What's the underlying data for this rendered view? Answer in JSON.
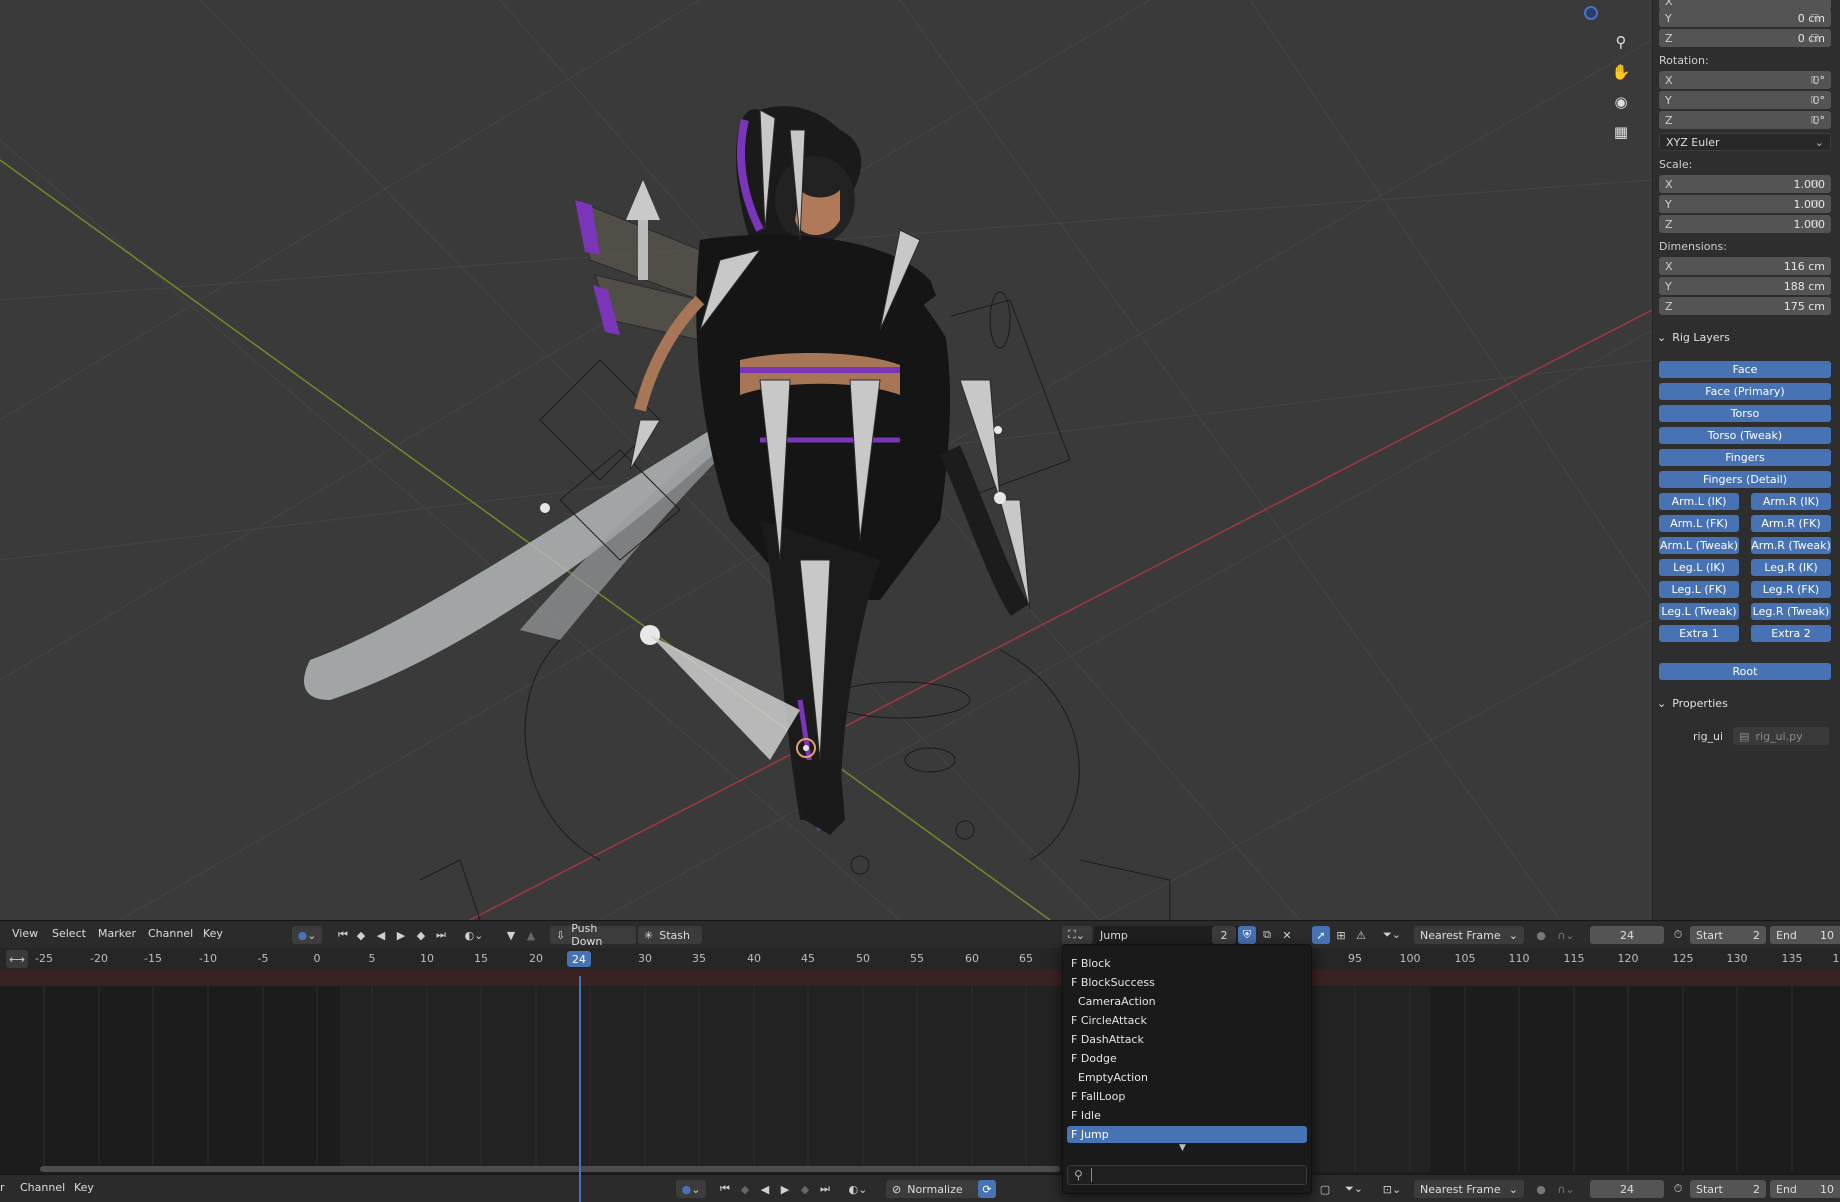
{
  "npanel": {
    "location_y": {
      "axis": "Y",
      "value": "0 cm"
    },
    "location_z": {
      "axis": "Z",
      "value": "0 cm"
    },
    "rotation_label": "Rotation:",
    "rotation": [
      {
        "axis": "X",
        "value": "0°"
      },
      {
        "axis": "Y",
        "value": "0°"
      },
      {
        "axis": "Z",
        "value": "0°"
      }
    ],
    "rotation_mode": "XYZ Euler",
    "scale_label": "Scale:",
    "scale": [
      {
        "axis": "X",
        "value": "1.000"
      },
      {
        "axis": "Y",
        "value": "1.000"
      },
      {
        "axis": "Z",
        "value": "1.000"
      }
    ],
    "dimensions_label": "Dimensions:",
    "dimensions": [
      {
        "axis": "X",
        "value": "116 cm"
      },
      {
        "axis": "Y",
        "value": "188 cm"
      },
      {
        "axis": "Z",
        "value": "175 cm"
      }
    ],
    "rig_layers_title": "Rig Layers",
    "rig_layers": {
      "face": "Face",
      "face_primary": "Face (Primary)",
      "torso": "Torso",
      "torso_tweak": "Torso (Tweak)",
      "fingers": "Fingers",
      "fingers_detail": "Fingers (Detail)",
      "arm_l_ik": "Arm.L (IK)",
      "arm_r_ik": "Arm.R (IK)",
      "arm_l_fk": "Arm.L (FK)",
      "arm_r_fk": "Arm.R (FK)",
      "arm_l_tweak": "Arm.L (Tweak)",
      "arm_r_tweak": "Arm.R (Tweak)",
      "leg_l_ik": "Leg.L (IK)",
      "leg_r_ik": "Leg.R (IK)",
      "leg_l_fk": "Leg.L (FK)",
      "leg_r_fk": "Leg.R (FK)",
      "leg_l_tweak": "Leg.L (Tweak)",
      "leg_r_tweak": "Leg.R (Tweak)",
      "extra_1": "Extra 1",
      "extra_2": "Extra 2",
      "root": "Root"
    },
    "properties_title": "Properties",
    "prop_name": "rig_ui",
    "prop_file": "rig_ui.py",
    "accent": "#4772b3"
  },
  "editor": {
    "menu": {
      "view": "View",
      "select": "Select",
      "marker": "Marker",
      "channel": "Channel",
      "key": "Key"
    },
    "push_down": "Push Down",
    "stash": "Stash",
    "action_name": "Jump",
    "action_users": "2",
    "snap_mode": "Nearest Frame",
    "current_frame": "24",
    "start_label": "Start",
    "start_value": "2",
    "end_label": "End",
    "end_value": "10",
    "ruler_ticks_left": [
      "-25",
      "-20",
      "-15",
      "-10",
      "-5",
      "0",
      "5",
      "10",
      "15",
      "20",
      "24",
      "30",
      "35",
      "40",
      "45",
      "50",
      "55",
      "60",
      "65"
    ],
    "ruler_ticks_right": [
      "95",
      "100",
      "105",
      "110",
      "115",
      "120",
      "125",
      "130",
      "135",
      "1"
    ],
    "footer": {
      "left_cut": "r",
      "channel": "Channel",
      "key": "Key",
      "normalize": "Normalize",
      "snap_mode": "Nearest Frame",
      "current_frame": "24",
      "start_label": "Start",
      "start_value": "2",
      "end_label": "End",
      "end_value": "10"
    }
  },
  "action_popup": {
    "items": [
      "F Block",
      "F BlockSuccess",
      "  CameraAction",
      "F CircleAttack",
      "F DashAttack",
      "F Dodge",
      "  EmptyAction",
      "F FallLoop",
      "F Idle",
      "F Jump"
    ],
    "selected": "F Jump",
    "search_placeholder": ""
  }
}
